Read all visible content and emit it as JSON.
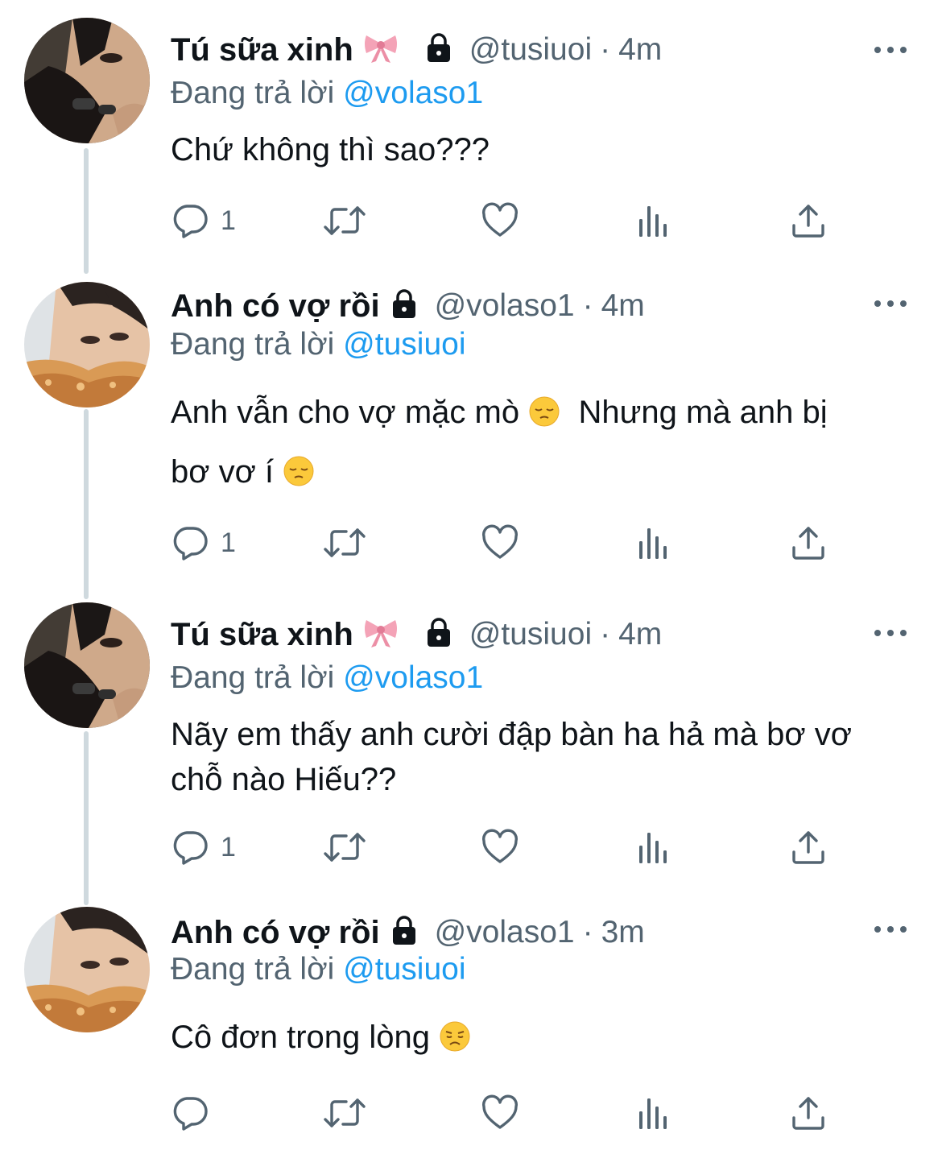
{
  "tweets": [
    {
      "name": "Tú sữa xinh",
      "handle": "@tusiuoi",
      "time": "4m",
      "reply_label": "Đang trả lời",
      "reply_to": "@volaso1",
      "text": "Chứ không thì sao???",
      "text2": "",
      "reply_count": "1",
      "avatar": "dark-portrait-hand-rings"
    },
    {
      "name": "Anh có vợ rồi",
      "handle": "@volaso1",
      "time": "4m",
      "reply_label": "Đang trả lời",
      "reply_to": "@tusiuoi",
      "text": "Anh vẫn cho vợ mặc mò",
      "text_after_emoji": "Nhưng mà anh bị",
      "text2": "bơ vơ í",
      "reply_count": "1",
      "avatar": "portrait-with-food"
    },
    {
      "name": "Tú sữa xinh",
      "handle": "@tusiuoi",
      "time": "4m",
      "reply_label": "Đang trả lời",
      "reply_to": "@volaso1",
      "text": "Nãy em thấy anh cười đập bàn ha hả mà bơ vơ",
      "text2": "chỗ nào Hiếu??",
      "reply_count": "1",
      "avatar": "dark-portrait-hand-rings"
    },
    {
      "name": "Anh có vợ rồi",
      "handle": "@volaso1",
      "time": "3m",
      "reply_label": "Đang trả lời",
      "reply_to": "@tusiuoi",
      "text": "Cô đơn trong lòng",
      "text2": "",
      "reply_count": "",
      "avatar": "portrait-with-food"
    }
  ],
  "separator": "·",
  "colors": {
    "text": "#0f1419",
    "secondary": "#536471",
    "link": "#1d9bf0",
    "thread_line": "#cfd9de"
  }
}
